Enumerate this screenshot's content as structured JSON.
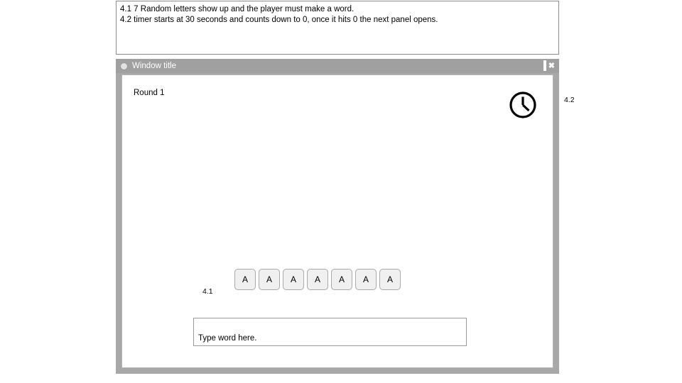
{
  "notes": {
    "lines": [
      "4.1 7 Random letters show up and the player must make a word.",
      "4.2 timer starts at 30 seconds and counts down to 0, once it hits 0 the next panel opens."
    ]
  },
  "window": {
    "title": "Window title",
    "controls": {
      "minimize": "minimize-control",
      "maximize": "maximize-control",
      "close": "✖"
    }
  },
  "content": {
    "round_label": "Round 1",
    "timer_icon": "clock-icon",
    "tiles": [
      {
        "letter": "A"
      },
      {
        "letter": "A"
      },
      {
        "letter": "A"
      },
      {
        "letter": "A"
      },
      {
        "letter": "A"
      },
      {
        "letter": "A"
      },
      {
        "letter": "A"
      }
    ],
    "word_input": {
      "placeholder": "Type word here.",
      "value": ""
    }
  },
  "callouts": {
    "tiles_ref": "4.1",
    "timer_ref": "4.2"
  },
  "colors": {
    "page_background": "#ffffff",
    "window_frame": "#a8a8a8",
    "title_bar": "#a0a0a0",
    "title_text": "#ffffff",
    "canvas": "#ffffff",
    "tile_fill": "#f0f0f0",
    "tile_border": "#a9a9a9",
    "input_border": "#9a9a9a",
    "note_border": "#8c8c8c",
    "text": "#000000"
  }
}
